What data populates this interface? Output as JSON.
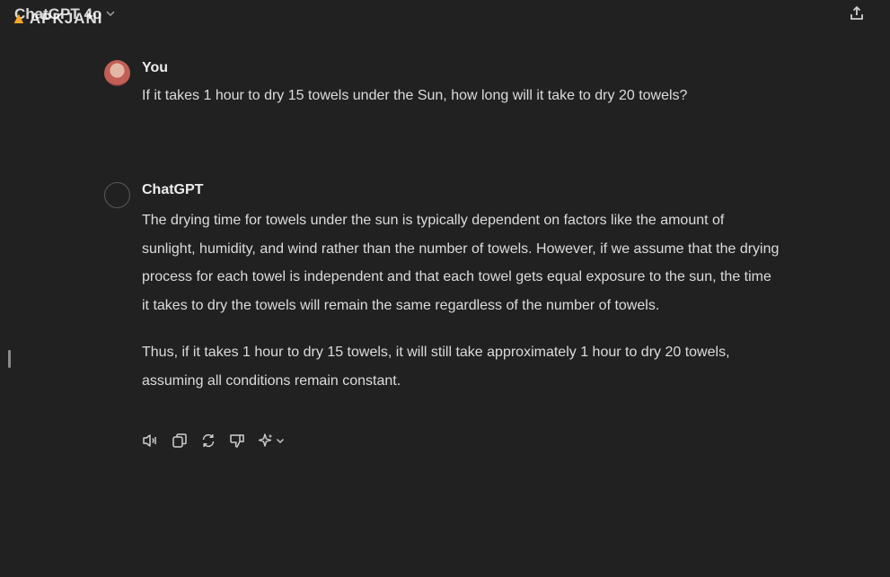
{
  "header": {
    "title": "ChatGPT 4o",
    "model_chevron_icon": "chevron-down-icon",
    "share_icon": "share-upload-icon"
  },
  "watermark": {
    "text": "APKJANI"
  },
  "conversation": {
    "user_message": {
      "author": "You",
      "text": "If it takes 1 hour to dry 15 towels under the Sun, how long will it take to dry 20 towels?"
    },
    "assistant_message": {
      "author": "ChatGPT",
      "paragraphs": [
        "The drying time for towels under the sun is typically dependent on factors like the amount of sunlight, humidity, and wind rather than the number of towels. However, if we assume that the drying process for each towel is independent and that each towel gets equal exposure to the sun, the time it takes to dry the towels will remain the same regardless of the number of towels.",
        "Thus, if it takes 1 hour to dry 15 towels, it will still take approximately 1 hour to dry 20 towels, assuming all conditions remain constant."
      ],
      "actions": [
        "read-aloud-icon",
        "copy-icon",
        "regenerate-icon",
        "thumbs-down-icon",
        "sparkle-model-icon"
      ]
    }
  },
  "colors": {
    "background": "#212121",
    "text": "#ececec",
    "watermark_accent": "#f5a623"
  }
}
